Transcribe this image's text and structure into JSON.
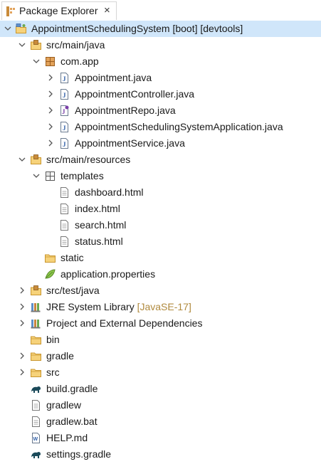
{
  "tab": {
    "title": "Package Explorer",
    "close_glyph": "×"
  },
  "tree": {
    "project": {
      "label": "AppointmentSchedulingSystem [boot] [devtools]"
    },
    "src_main_java": {
      "label": "src/main/java"
    },
    "com_app": {
      "label": "com.app"
    },
    "files_java": [
      {
        "label": "Appointment.java",
        "icon": "java-class-icon"
      },
      {
        "label": "AppointmentController.java",
        "icon": "java-class-icon"
      },
      {
        "label": "AppointmentRepo.java",
        "icon": "java-interface-icon"
      },
      {
        "label": "AppointmentSchedulingSystemApplication.java",
        "icon": "java-class-icon"
      },
      {
        "label": "AppointmentService.java",
        "icon": "java-class-icon"
      }
    ],
    "src_main_resources": {
      "label": "src/main/resources"
    },
    "templates": {
      "label": "templates"
    },
    "templates_files": [
      {
        "label": "dashboard.html"
      },
      {
        "label": "index.html"
      },
      {
        "label": "search.html"
      },
      {
        "label": "status.html"
      }
    ],
    "static": {
      "label": "static"
    },
    "application_properties": {
      "label": "application.properties"
    },
    "src_test_java": {
      "label": "src/test/java"
    },
    "jre": {
      "label": "JRE System Library",
      "decoration": "[JavaSE-17]"
    },
    "deps": {
      "label": "Project and External Dependencies"
    },
    "bin": {
      "label": "bin"
    },
    "gradle": {
      "label": "gradle"
    },
    "src": {
      "label": "src"
    },
    "build_gradle": {
      "label": "build.gradle"
    },
    "gradlew": {
      "label": "gradlew"
    },
    "gradlew_bat": {
      "label": "gradlew.bat"
    },
    "help_md": {
      "label": "HELP.md"
    },
    "settings_gradle": {
      "label": "settings.gradle"
    }
  },
  "colors": {
    "selection": "#d0e6fa",
    "folder": "#e8b94a",
    "package": "#b07a2a",
    "java": "#2f5fa8",
    "decoration": "#b08a3e",
    "gradle": "#1b4a5a"
  }
}
